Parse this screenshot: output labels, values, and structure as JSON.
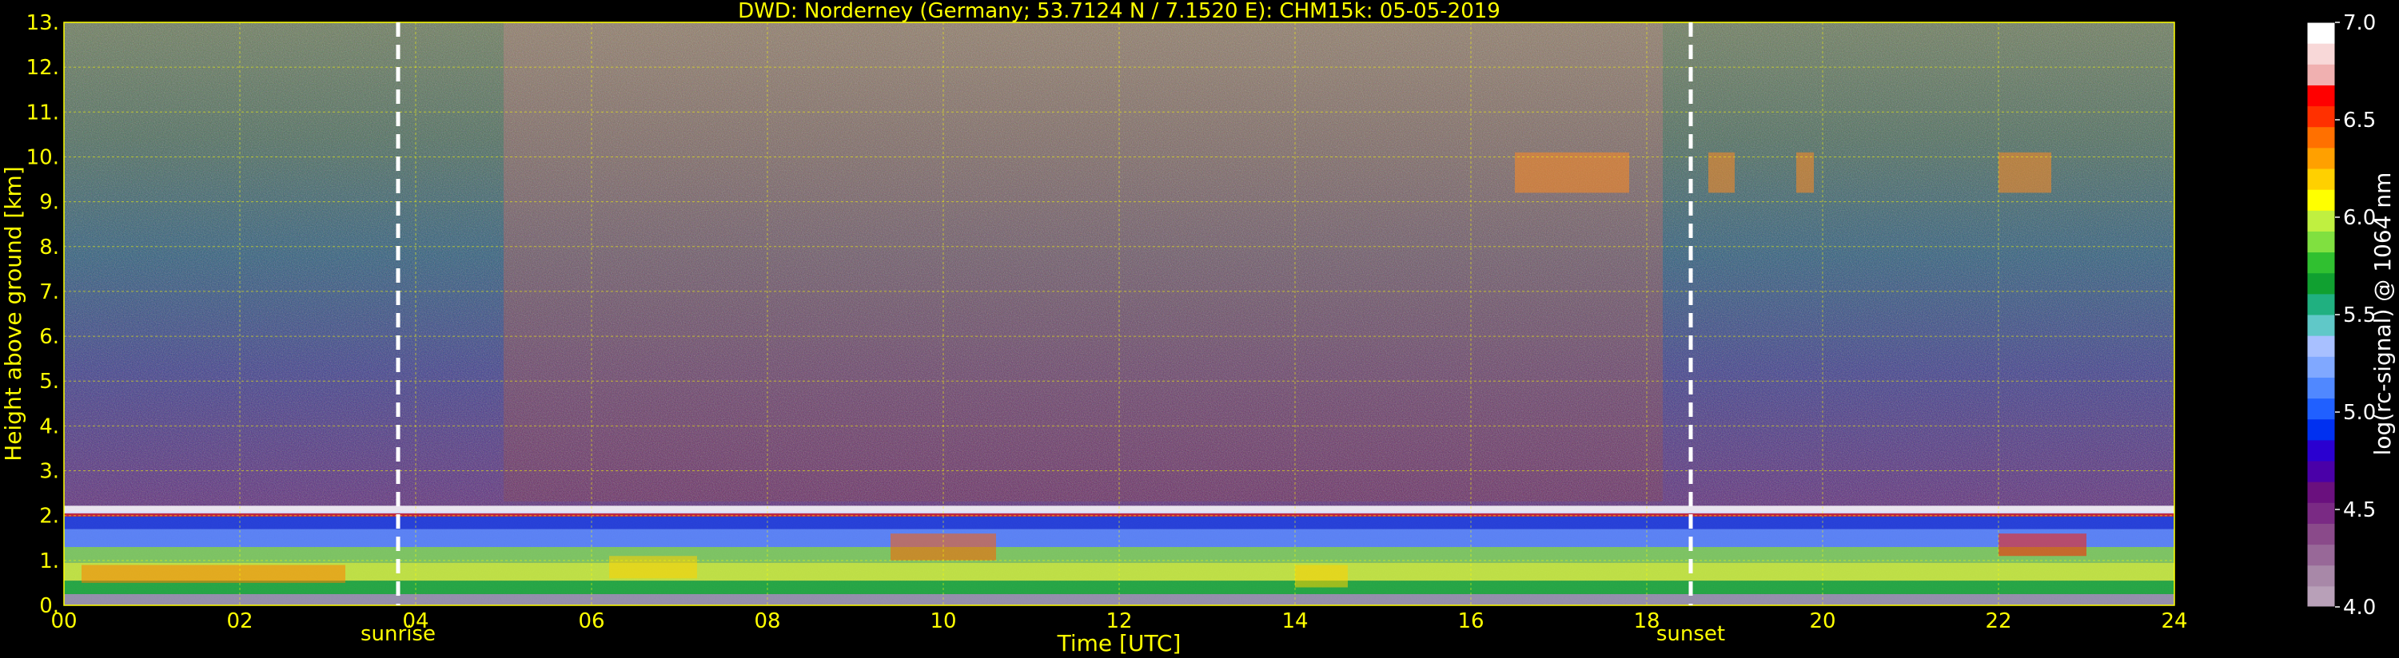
{
  "chart_data": {
    "type": "heatmap",
    "title": "DWD: Norderney (Germany; 53.7124 N / 7.1520 E):    CHM15k: 05-05-2019",
    "xlabel": "Time [UTC]",
    "ylabel": "Height above ground [km]",
    "xlim": [
      0,
      24
    ],
    "ylim": [
      0,
      13
    ],
    "x_ticks": [
      "00",
      "02",
      "04",
      "06",
      "08",
      "10",
      "12",
      "14",
      "16",
      "18",
      "20",
      "22",
      "24"
    ],
    "y_ticks": [
      "0.",
      "1.",
      "2.",
      "3.",
      "4.",
      "5.",
      "6.",
      "7.",
      "8.",
      "9.",
      "10.",
      "11.",
      "12.",
      "13."
    ],
    "grid": true,
    "events": [
      {
        "label": "sunrise",
        "x": 3.8
      },
      {
        "label": "sunset",
        "x": 18.5
      }
    ],
    "colorbar": {
      "label": "log(rc-signal) @ 1064 nm",
      "range": [
        4.0,
        7.0
      ],
      "ticks": [
        "4.0",
        "4.5",
        "5.0",
        "5.5",
        "6.0",
        "6.5",
        "7.0"
      ],
      "colors": [
        "#b8a0b8",
        "#a888a8",
        "#986898",
        "#8a4a8a",
        "#7a2a84",
        "#6a107e",
        "#4a00a8",
        "#2a00d0",
        "#0030f0",
        "#2060ff",
        "#5088ff",
        "#80a8ff",
        "#a8c0ff",
        "#60c8c8",
        "#20b080",
        "#10a030",
        "#30c030",
        "#80e040",
        "#c0f040",
        "#ffff00",
        "#ffd000",
        "#ffa000",
        "#ff7000",
        "#ff3000",
        "#ff0000",
        "#f0b0b0",
        "#f8d8d8",
        "#ffffff"
      ]
    },
    "features": {
      "boundary_layer_top_km": 2.1,
      "high_cloud_height_km": [
        9.2,
        10.1
      ],
      "high_cloud_times_utc": [
        [
          16.5,
          17.8
        ],
        [
          18.7,
          19.0
        ],
        [
          19.7,
          19.9
        ],
        [
          22.0,
          22.6
        ]
      ]
    }
  }
}
